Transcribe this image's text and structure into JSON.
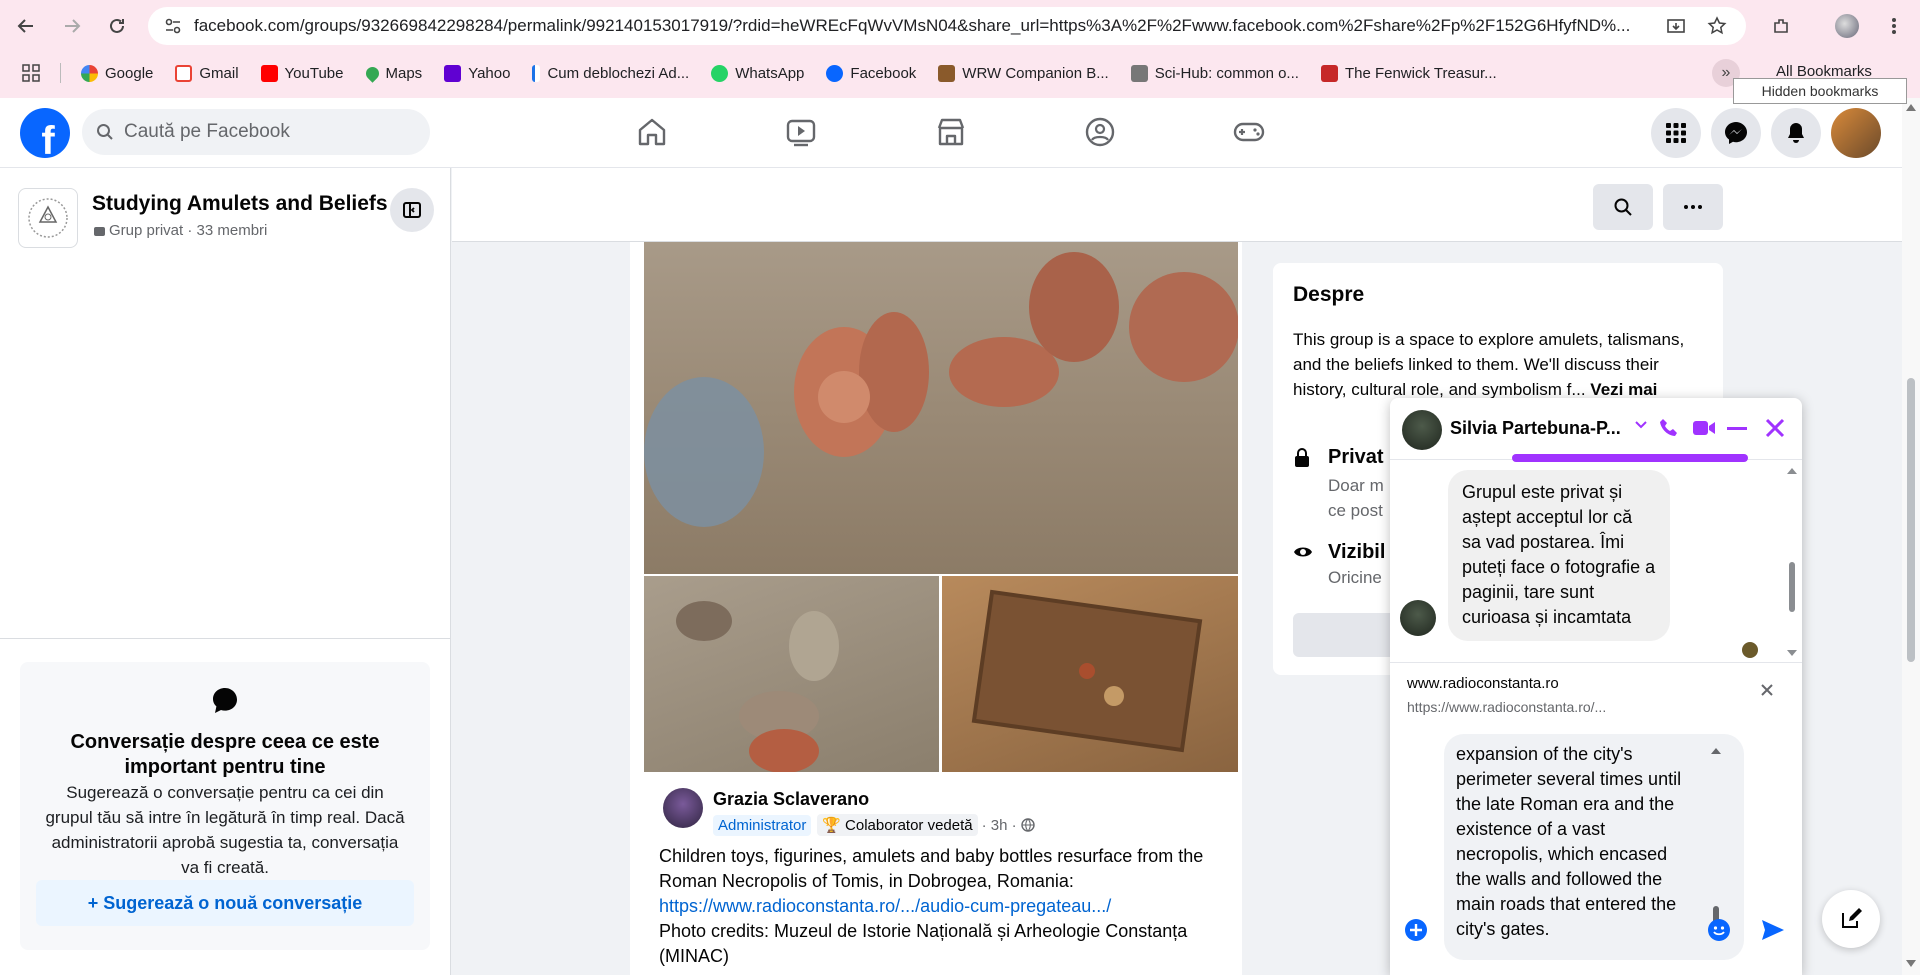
{
  "browser": {
    "url": "facebook.com/groups/932669842298284/permalink/992140153017919/?rdid=heWREcFqWvVMsN04&share_url=https%3A%2F%2Fwww.facebook.com%2Fshare%2Fp%2F152G6HfyfND%...",
    "bookmarks": [
      "Google",
      "Gmail",
      "YouTube",
      "Maps",
      "Yahoo",
      "Cum deblochezi Ad...",
      "WhatsApp",
      "Facebook",
      "WRW Companion B...",
      "Sci-Hub: common o...",
      "The Fenwick Treasur..."
    ],
    "all_bookmarks": "All Bookmarks",
    "tooltip": "Hidden bookmarks"
  },
  "header": {
    "search_placeholder": "Caută pe Facebook",
    "logo": "f"
  },
  "group": {
    "name": "Studying Amulets and Beliefs",
    "meta": "Grup privat · 33 membri"
  },
  "suggestion": {
    "title": "Conversație despre ceea ce este important pentru tine",
    "body": "Sugerează o conversație pentru ca cei din grupul tău să intre în legătură în timp real. Dacă administratorii aprobă sugestia ta, conversația va fi creată.",
    "button": "+ Sugerează o nouă conversație"
  },
  "post": {
    "author": "Grazia Sclaverano",
    "badge_admin": "Administrator",
    "badge_contrib": "Colaborator vedetă",
    "time": "· 3h ·",
    "text": "Children toys, figurines, amulets and baby bottles resurface from the Roman Necropolis of Tomis, in Dobrogea, Romania:",
    "link": "https://www.radioconstanta.ro/.../audio-cum-pregateau.../",
    "credits": "Photo credits: Muzeul de Istorie Națională și Arheologie Constanța (MINAC)"
  },
  "about": {
    "title": "Despre",
    "description": "This group is a space to explore amulets, talismans, and the beliefs linked to them. We'll discuss their history, cultural role, and symbolism f...",
    "see_more": "Vezi mai",
    "private_title": "Privat",
    "private_desc1": "Doar m",
    "private_desc2": "ce post",
    "visible_title": "Vizibil",
    "visible_desc": "Oricine"
  },
  "chat": {
    "name": "Silvia Partebuna-P...",
    "message": "Grupul este privat și aștept acceptul lor că sa vad postarea. Îmi puteți face o fotografie a paginii, tare sunt curioasa și incamtata",
    "link_domain": "www.radioconstanta.ro",
    "link_url": "https://www.radioconstanta.ro/...",
    "draft": "expansion of the city's perimeter several times until the late Roman era and the existence of a vast necropolis, which encased the walls and followed the main roads that entered the city's gates."
  },
  "colors": {
    "fb_blue": "#0866ff",
    "messenger_purple": "#a033ff",
    "chrome_bg": "#fce7ef"
  }
}
